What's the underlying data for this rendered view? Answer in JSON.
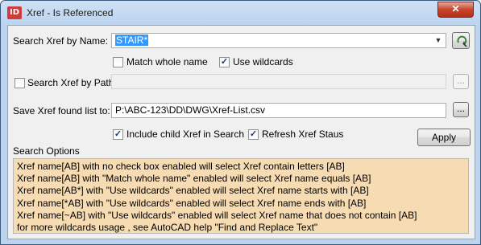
{
  "window": {
    "title": "Xref - Is Referenced",
    "app_icon_text": "ID",
    "close_label": "✕"
  },
  "search_name": {
    "label": "Search Xref by Name:",
    "value": "STAIR*",
    "match_whole_name": {
      "label": "Match whole name",
      "checked": false
    },
    "use_wildcards": {
      "label": "Use wildcards",
      "checked": true
    }
  },
  "search_path": {
    "label": "Search Xref by Path",
    "checked": false,
    "value": "",
    "browse_label": "..."
  },
  "save_list": {
    "label": "Save Xref found list to:",
    "value": "P:\\ABC-123\\DD\\DWG\\Xref-List.csv",
    "browse_label": "..."
  },
  "include_child": {
    "label": "Include child Xref in Search",
    "checked": true
  },
  "refresh_xref": {
    "label": "Refresh Xref Staus",
    "checked": true
  },
  "apply_label": "Apply",
  "search_options": {
    "label": "Search Options",
    "lines": [
      "Xref name[AB] with no check box enabled will select Xref contain letters [AB]",
      "Xref name[AB] with \"Match whole name\" enabled will select Xref name equals [AB]",
      "Xref name[AB*] with \"Use wildcards\" enabled will select Xref name starts with [AB]",
      "Xref name[*AB] with \"Use wildcards\" enabled will select Xref name ends with [AB]",
      "Xref name[~AB] with \"Use wildcards\" enabled will select Xref name that does not contain [AB]",
      "for more wildcards usage , see AutoCAD help  \"Find and Replace Text\""
    ]
  },
  "colors": {
    "options_background": "#f6dbb3",
    "selection": "#3399ff",
    "close_button": "#c7442c"
  }
}
